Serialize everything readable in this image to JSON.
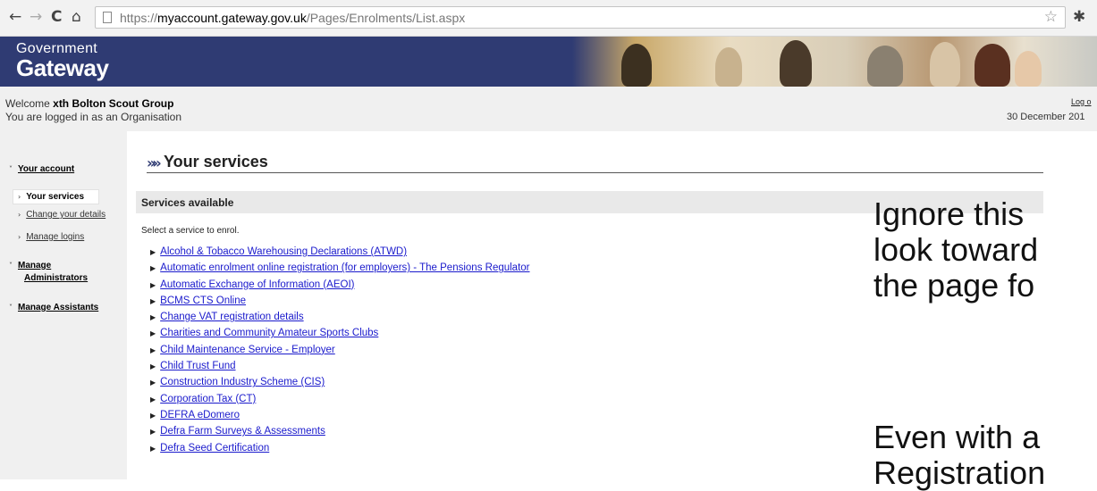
{
  "browser": {
    "url_scheme": "https://",
    "url_host": "myaccount.gateway.gov.uk",
    "url_path": "/Pages/Enrolments/List.aspx",
    "icons": [
      "back-arrow-icon",
      "forward-arrow-icon",
      "reload-icon",
      "home-icon",
      "page-icon",
      "star-icon",
      "extension-icon"
    ]
  },
  "banner": {
    "logo_small": "Government",
    "logo_big": "Gateway",
    "background_color": "#2f3b73"
  },
  "welcome": {
    "prefix": "Welcome ",
    "name": "xth Bolton Scout Group",
    "logged_in_as": "You are logged in as an Organisation",
    "logout": "Log o",
    "date": "30 December 201"
  },
  "sidebar": {
    "your_account": "Your account",
    "your_services": "Your services",
    "change_details": "Change your details",
    "manage_logins": "Manage logins",
    "manage_admins_line1": "Manage",
    "manage_admins_line2": "Administrators",
    "manage_assistants": "Manage Assistants"
  },
  "main": {
    "title": "Your services",
    "services_heading": "Services available",
    "instruction": "Select a service to enrol.",
    "services": [
      "Alcohol & Tobacco Warehousing Declarations (ATWD)",
      "Automatic enrolment online registration (for employers) - The Pensions Regulator",
      "Automatic Exchange of Information (AEOI)",
      "BCMS CTS Online",
      "Change VAT registration details",
      "Charities and Community Amateur Sports Clubs",
      "Child Maintenance Service - Employer",
      "Child Trust Fund",
      "Construction Industry Scheme (CIS)",
      "Corporation Tax (CT)",
      "DEFRA eDomero",
      "Defra Farm Surveys & Assessments",
      "Defra Seed Certification"
    ]
  },
  "overlay": {
    "line1": "Ignore this",
    "line2": "look toward",
    "line3": "the page fo",
    "line4": "Even with a",
    "line5": "Registration"
  }
}
